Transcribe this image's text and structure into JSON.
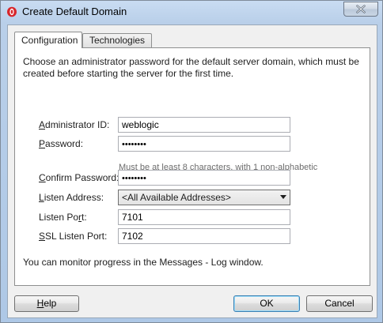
{
  "window": {
    "title": "Create Default Domain"
  },
  "tabs": [
    {
      "label": "Configuration",
      "active": true
    },
    {
      "label": "Technologies",
      "active": false
    }
  ],
  "intro_text": "Choose an administrator password for the default server domain, which must be created before starting the server for the first time.",
  "fields": {
    "admin_id": {
      "label_mn": "A",
      "label_rest": "dministrator ID:",
      "value": "weblogic"
    },
    "password": {
      "label_mn": "P",
      "label_rest": "assword:",
      "value": "••••••••"
    },
    "password_hint": "Must be at least 8 characters, with 1 non-alphabetic",
    "confirm_password": {
      "label_mn": "C",
      "label_rest": "onfirm Password:",
      "value": "••••••••"
    },
    "listen_address": {
      "label_mn": "L",
      "label_rest": "isten Address:",
      "value": "<All Available Addresses>"
    },
    "listen_port": {
      "label_pre": "Listen Po",
      "label_mn": "r",
      "label_rest": "t:",
      "value": "7101"
    },
    "ssl_listen_port": {
      "label_mn": "S",
      "label_rest": "SL Listen Port:",
      "value": "7102"
    }
  },
  "monitor_text": "You can monitor progress in the Messages - Log window.",
  "buttons": {
    "help_mn": "H",
    "help_rest": "elp",
    "ok": "OK",
    "cancel": "Cancel"
  },
  "colors": {
    "title_bar": "#b9cfe9",
    "dialog_bg": "#f0f0f0",
    "close_x": "#ffffff",
    "default_button_border": "#3c7fb1"
  }
}
